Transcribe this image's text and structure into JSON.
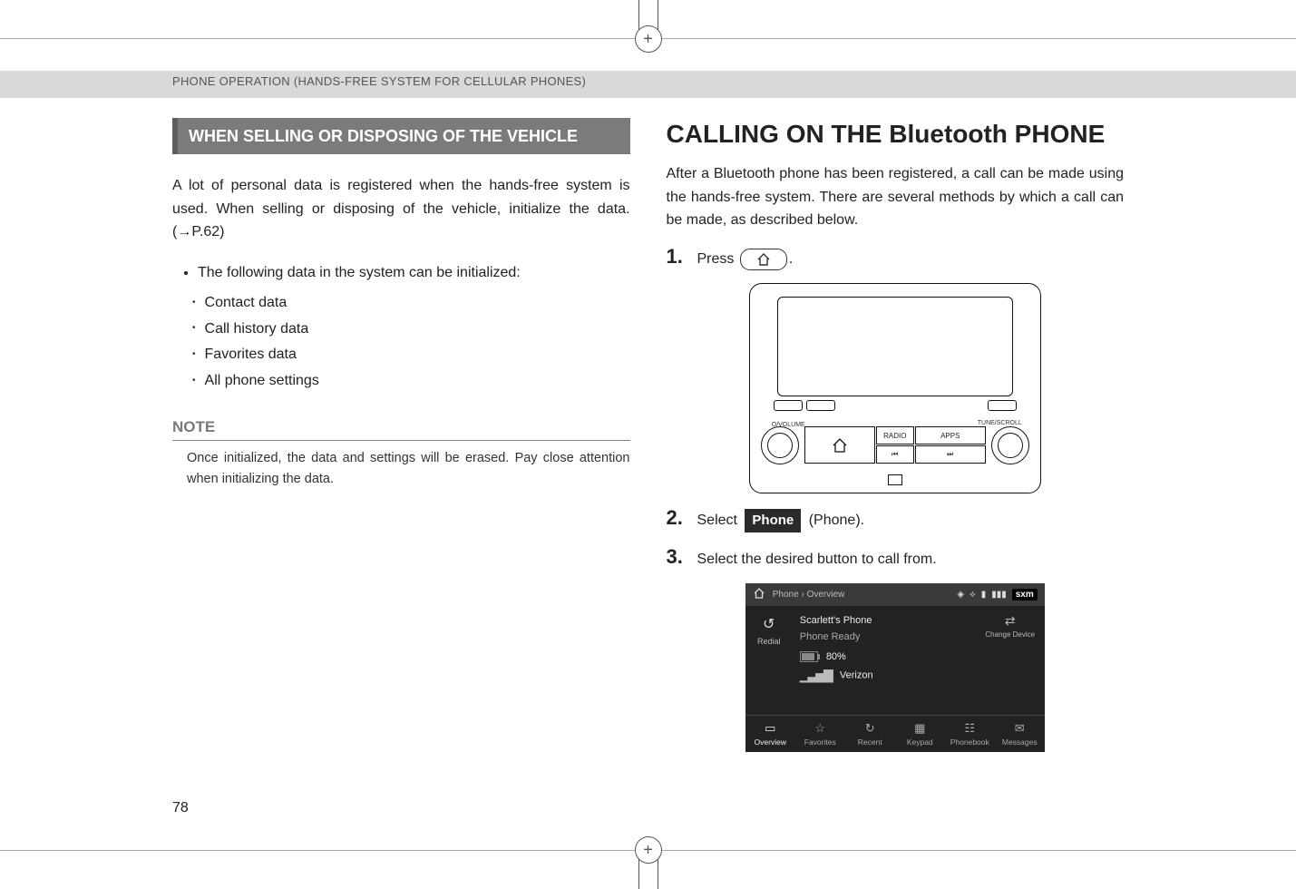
{
  "header": "PHONE OPERATION (HANDS-FREE SYSTEM FOR CELLULAR PHONES)",
  "page_number": "78",
  "left": {
    "section_title": "WHEN SELLING OR DISPOSING OF THE VEHICLE",
    "paragraph": "A lot of personal data is registered when the hands-free system is used. When selling or disposing of the vehicle, initialize the data. (→P.62)",
    "bullet": "The following data in the system can be initialized:",
    "sub": [
      "Contact data",
      "Call history data",
      "Favorites data",
      "All phone settings"
    ],
    "note_heading": "NOTE",
    "note_text": "Once initialized, the data and settings will be erased. Pay close attention when initializing the data."
  },
  "right": {
    "title": "CALLING ON THE Bluetooth PHONE",
    "intro": "After a Bluetooth phone has been registered, a call can be made using the hands-free system. There are several methods by which a call can be made, as described below.",
    "steps": {
      "s1_num": "1.",
      "s1_text_a": "Press",
      "s1_text_b": ".",
      "s2_num": "2.",
      "s2_text_a": "Select",
      "s2_pill": "Phone",
      "s2_text_b": "(Phone).",
      "s3_num": "3.",
      "s3_text": "Select the desired button to call from."
    },
    "device": {
      "left_label": "O/VOLUME",
      "right_label": "TUNE/SCROLL",
      "radio": "RADIO",
      "apps": "APPS",
      "prev": "⏮",
      "next": "⏭"
    },
    "screenshot": {
      "breadcrumb_a": "Phone",
      "breadcrumb_sep": "›",
      "breadcrumb_b": "Overview",
      "sxm": "sxm",
      "redial": "Redial",
      "change_device": "Change Device",
      "phone_name": "Scarlett's Phone",
      "phone_status": "Phone Ready",
      "battery": "80%",
      "carrier": "Verizon",
      "tabs": {
        "overview": "Overview",
        "favorites": "Favorites",
        "recent": "Recent",
        "keypad": "Keypad",
        "phonebook": "Phonebook",
        "messages": "Messages"
      }
    }
  }
}
